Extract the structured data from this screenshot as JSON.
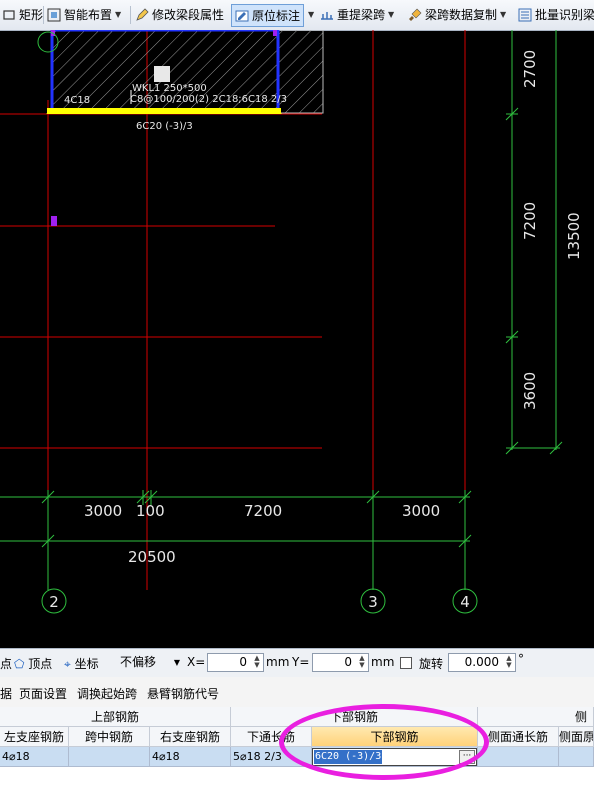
{
  "toolbar": {
    "items": [
      {
        "label": "矩形",
        "icon": "rectangle-icon"
      },
      {
        "label": "智能布置",
        "icon": "smart-layout-icon",
        "dropdown": true
      },
      {
        "label": "修改梁段属性",
        "icon": "edit-beam-icon"
      },
      {
        "label": "原位标注",
        "icon": "in-situ-annotation-icon",
        "active": true,
        "dropdown": true
      },
      {
        "label": "重提梁跨",
        "icon": "re-extract-span-icon",
        "dropdown": true
      },
      {
        "label": "梁跨数据复制",
        "icon": "brush-copy-icon",
        "dropdown": true
      },
      {
        "label": "批量识别梁",
        "icon": "batch-identify-icon"
      }
    ]
  },
  "drawing": {
    "beam_label_1": "WKL1 250*500",
    "beam_label_2": "C8@100/200(2) 2C18;6C18 2/3",
    "support_left_label": "4C18",
    "bottom_rebar_label": "6C20 (-3)/3",
    "dim_right_1": "2700",
    "dim_right_2": "7200",
    "dim_right_3": "3600",
    "dim_right_total": "13500",
    "dim_bottom_1": "3000",
    "dim_bottom_2": "100",
    "dim_bottom_3": "7200",
    "dim_bottom_4": "3000",
    "dim_bottom_total": "20500",
    "axis_2": "2",
    "axis_3": "3",
    "axis_4": "4"
  },
  "draw_bar": {
    "point_label": "点",
    "vertex_label": "顶点",
    "coord_label": "坐标",
    "offset_mode": "不偏移",
    "x_label": "X=",
    "x_value": "0",
    "x_unit": "mm",
    "y_label": "Y=",
    "y_value": "0",
    "y_unit": "mm",
    "rotate_label": "旋转",
    "rotate_value": "0.000",
    "degree": "°"
  },
  "menu": {
    "items": [
      "据",
      "页面设置",
      "调换起始跨",
      "悬臂钢筋代号"
    ]
  },
  "grid": {
    "group_top": "上部钢筋",
    "group_bottom": "下部钢筋",
    "group_side": "侧",
    "columns": [
      "左支座钢筋",
      "跨中钢筋",
      "右支座钢筋",
      "下通长筋",
      "下部钢筋",
      "侧面通长筋",
      "侧面原"
    ],
    "row": {
      "left_support": "4⌀18",
      "mid_span": "",
      "right_support": "4⌀18",
      "bottom_continuous": "5⌀18 2/3",
      "bottom_rebar": "6C20 (-3)/3",
      "side_continuous": "",
      "side_original": ""
    },
    "ellipsis": "···"
  },
  "colors": {
    "highlight": "#e91fe0",
    "grid_red": "#d40000",
    "dim_green": "#2fbf3f",
    "beam_yellow": "#ffff00",
    "beam_blue": "#2233ff",
    "axis_purple": "#a020f0"
  }
}
